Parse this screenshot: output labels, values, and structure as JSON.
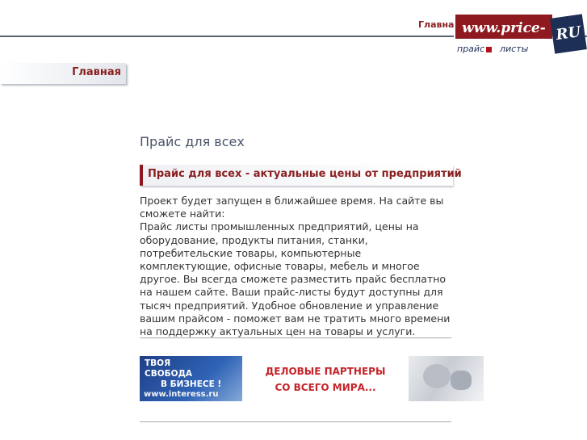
{
  "header": {
    "nav_home": "Главная",
    "logo_main": "www.price-all.",
    "logo_ru": "RU",
    "logo_sub_1": "прайс",
    "logo_sub_2": "листы"
  },
  "sidebar": {
    "home_tab": "Главная"
  },
  "main": {
    "title": "Прайс для всех",
    "subheading": "Прайс для всех - актуальные цены от предприятий",
    "paragraph": "Проект будет запущен в ближайшее время. На сайте вы сможете найти:\nПрайс листы промышленных предприятий, цены на оборудование, продукты питания, станки, потребительские товары, компьютерные комплектующие, офисные товары, мебель и многое другое. Вы всегда сможете разместить прайс бесплатно на нашем сайте. Ваши прайс-листы будут доступны для тысяч предприятий. Удобное обновление и управление вашим прайсом - поможет вам не тратить много времени на поддержку актуальных цен на товары и услуги."
  },
  "banner": {
    "left_line1": "ТВОЯ",
    "left_line2": "СВОБОДА",
    "left_line3": "В БИЗНЕСЕ !",
    "left_url": "www.interess.ru",
    "mid_line1": "ДЕЛОВЫЕ ПАРТНЕРЫ",
    "mid_line2": "СО ВСЕГО МИРА..."
  }
}
